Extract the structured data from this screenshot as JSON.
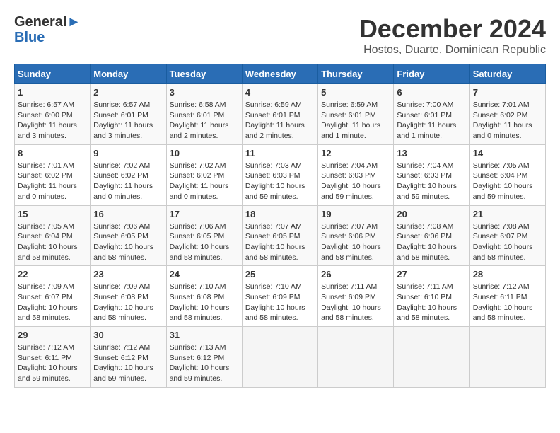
{
  "header": {
    "logo_general": "General",
    "logo_blue": "Blue",
    "month_title": "December 2024",
    "location": "Hostos, Duarte, Dominican Republic"
  },
  "days_of_week": [
    "Sunday",
    "Monday",
    "Tuesday",
    "Wednesday",
    "Thursday",
    "Friday",
    "Saturday"
  ],
  "weeks": [
    [
      {
        "day": "1",
        "sunrise": "6:57 AM",
        "sunset": "6:00 PM",
        "daylight": "11 hours and 3 minutes."
      },
      {
        "day": "2",
        "sunrise": "6:57 AM",
        "sunset": "6:01 PM",
        "daylight": "11 hours and 3 minutes."
      },
      {
        "day": "3",
        "sunrise": "6:58 AM",
        "sunset": "6:01 PM",
        "daylight": "11 hours and 2 minutes."
      },
      {
        "day": "4",
        "sunrise": "6:59 AM",
        "sunset": "6:01 PM",
        "daylight": "11 hours and 2 minutes."
      },
      {
        "day": "5",
        "sunrise": "6:59 AM",
        "sunset": "6:01 PM",
        "daylight": "11 hours and 1 minute."
      },
      {
        "day": "6",
        "sunrise": "7:00 AM",
        "sunset": "6:01 PM",
        "daylight": "11 hours and 1 minute."
      },
      {
        "day": "7",
        "sunrise": "7:01 AM",
        "sunset": "6:02 PM",
        "daylight": "11 hours and 0 minutes."
      }
    ],
    [
      {
        "day": "8",
        "sunrise": "7:01 AM",
        "sunset": "6:02 PM",
        "daylight": "11 hours and 0 minutes."
      },
      {
        "day": "9",
        "sunrise": "7:02 AM",
        "sunset": "6:02 PM",
        "daylight": "11 hours and 0 minutes."
      },
      {
        "day": "10",
        "sunrise": "7:02 AM",
        "sunset": "6:02 PM",
        "daylight": "11 hours and 0 minutes."
      },
      {
        "day": "11",
        "sunrise": "7:03 AM",
        "sunset": "6:03 PM",
        "daylight": "10 hours and 59 minutes."
      },
      {
        "day": "12",
        "sunrise": "7:04 AM",
        "sunset": "6:03 PM",
        "daylight": "10 hours and 59 minutes."
      },
      {
        "day": "13",
        "sunrise": "7:04 AM",
        "sunset": "6:03 PM",
        "daylight": "10 hours and 59 minutes."
      },
      {
        "day": "14",
        "sunrise": "7:05 AM",
        "sunset": "6:04 PM",
        "daylight": "10 hours and 59 minutes."
      }
    ],
    [
      {
        "day": "15",
        "sunrise": "7:05 AM",
        "sunset": "6:04 PM",
        "daylight": "10 hours and 58 minutes."
      },
      {
        "day": "16",
        "sunrise": "7:06 AM",
        "sunset": "6:05 PM",
        "daylight": "10 hours and 58 minutes."
      },
      {
        "day": "17",
        "sunrise": "7:06 AM",
        "sunset": "6:05 PM",
        "daylight": "10 hours and 58 minutes."
      },
      {
        "day": "18",
        "sunrise": "7:07 AM",
        "sunset": "6:05 PM",
        "daylight": "10 hours and 58 minutes."
      },
      {
        "day": "19",
        "sunrise": "7:07 AM",
        "sunset": "6:06 PM",
        "daylight": "10 hours and 58 minutes."
      },
      {
        "day": "20",
        "sunrise": "7:08 AM",
        "sunset": "6:06 PM",
        "daylight": "10 hours and 58 minutes."
      },
      {
        "day": "21",
        "sunrise": "7:08 AM",
        "sunset": "6:07 PM",
        "daylight": "10 hours and 58 minutes."
      }
    ],
    [
      {
        "day": "22",
        "sunrise": "7:09 AM",
        "sunset": "6:07 PM",
        "daylight": "10 hours and 58 minutes."
      },
      {
        "day": "23",
        "sunrise": "7:09 AM",
        "sunset": "6:08 PM",
        "daylight": "10 hours and 58 minutes."
      },
      {
        "day": "24",
        "sunrise": "7:10 AM",
        "sunset": "6:08 PM",
        "daylight": "10 hours and 58 minutes."
      },
      {
        "day": "25",
        "sunrise": "7:10 AM",
        "sunset": "6:09 PM",
        "daylight": "10 hours and 58 minutes."
      },
      {
        "day": "26",
        "sunrise": "7:11 AM",
        "sunset": "6:09 PM",
        "daylight": "10 hours and 58 minutes."
      },
      {
        "day": "27",
        "sunrise": "7:11 AM",
        "sunset": "6:10 PM",
        "daylight": "10 hours and 58 minutes."
      },
      {
        "day": "28",
        "sunrise": "7:12 AM",
        "sunset": "6:11 PM",
        "daylight": "10 hours and 58 minutes."
      }
    ],
    [
      {
        "day": "29",
        "sunrise": "7:12 AM",
        "sunset": "6:11 PM",
        "daylight": "10 hours and 59 minutes."
      },
      {
        "day": "30",
        "sunrise": "7:12 AM",
        "sunset": "6:12 PM",
        "daylight": "10 hours and 59 minutes."
      },
      {
        "day": "31",
        "sunrise": "7:13 AM",
        "sunset": "6:12 PM",
        "daylight": "10 hours and 59 minutes."
      },
      null,
      null,
      null,
      null
    ]
  ],
  "labels": {
    "sunrise": "Sunrise:",
    "sunset": "Sunset:",
    "daylight": "Daylight:"
  }
}
